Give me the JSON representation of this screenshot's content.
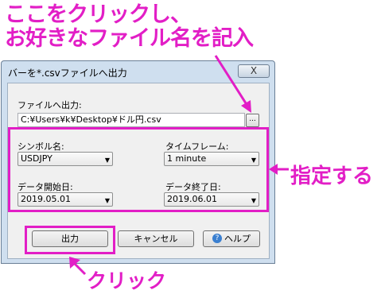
{
  "annotations": {
    "line1": "ここをクリックし、",
    "line2": "お好きなファイル名を記入",
    "side": "指定する",
    "bottom": "クリック"
  },
  "dialog": {
    "title": "バーを*.csvファイルへ出力",
    "close_symbol": "X",
    "output_label": "ファイルへ出力:",
    "file_path": "C:¥Users¥k¥Desktop¥ドル円.csv",
    "browse_label": "...",
    "symbol_label": "シンボル名:",
    "symbol_value": "USDJPY",
    "timeframe_label": "タイムフレーム:",
    "timeframe_value": "1 minute",
    "start_label": "データ開始日:",
    "start_value": "2019.05.01",
    "end_label": "データ終了日:",
    "end_value": "2019.06.01",
    "output_button": "出力",
    "cancel_button": "キャンセル",
    "help_button": "ヘルプ",
    "help_icon_glyph": "?"
  },
  "colors": {
    "annotation": "#e21ec6",
    "window_frame": "#cfdfef"
  }
}
